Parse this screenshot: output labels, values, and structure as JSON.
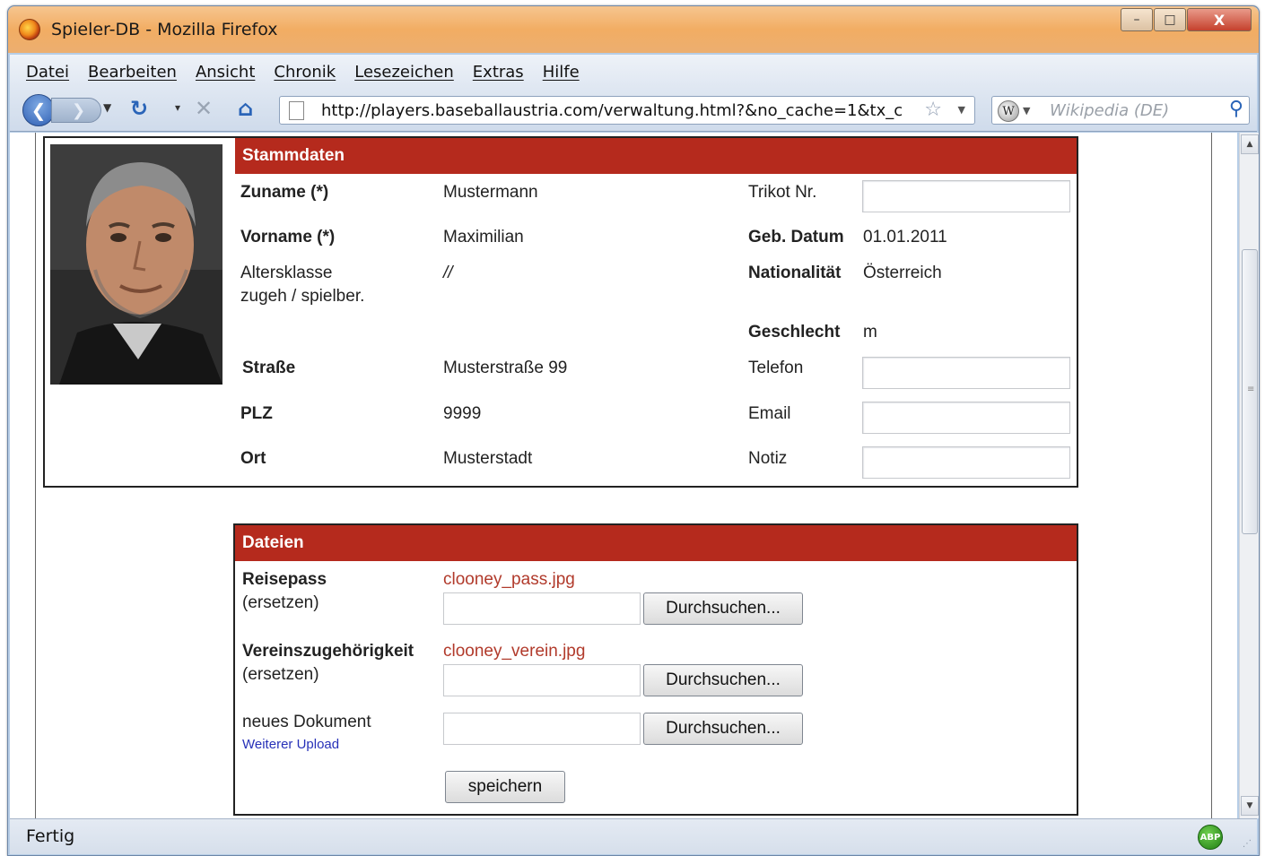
{
  "window": {
    "title": "Spieler-DB - Mozilla Firefox",
    "controls": {
      "minimize": "–",
      "maximize": "□",
      "close": "X"
    }
  },
  "menu": [
    "Datei",
    "Bearbeiten",
    "Ansicht",
    "Chronik",
    "Lesezeichen",
    "Extras",
    "Hilfe"
  ],
  "navigation": {
    "url": "http://players.baseballaustria.com/verwaltung.html?&no_cache=1&tx_c",
    "search_placeholder": "Wikipedia (DE)",
    "search_engine_icon": "W"
  },
  "status": {
    "text": "Fertig",
    "addon_badge": "ABP"
  },
  "stammdaten": {
    "heading": "Stammdaten",
    "zuname_label": "Zuname (*)",
    "zuname_value": "Mustermann",
    "vorname_label": "Vorname (*)",
    "vorname_value": "Maximilian",
    "altersklasse_label_1": "Altersklasse",
    "altersklasse_label_2": "zugeh / spielber.",
    "altersklasse_value": "//",
    "strasse_label": "Straße",
    "strasse_value": "Musterstraße 99",
    "plz_label": "PLZ",
    "plz_value": "9999",
    "ort_label": "Ort",
    "ort_value": "Musterstadt",
    "trikot_label": "Trikot Nr.",
    "trikot_value": "",
    "geburtsdatum_label": "Geb. Datum",
    "geburtsdatum_value": "01.01.2011",
    "nationalitaet_label": "Nationalität",
    "nationalitaet_value": "Österreich",
    "geschlecht_label": "Geschlecht",
    "geschlecht_value": "m",
    "telefon_label": "Telefon",
    "telefon_value": "",
    "email_label": "Email",
    "email_value": "",
    "notiz_label": "Notiz",
    "notiz_value": ""
  },
  "dateien": {
    "heading": "Dateien",
    "reisepass_label": "Reisepass",
    "reisepass_sub": "(ersetzen)",
    "reisepass_file": "clooney_pass.jpg",
    "verein_label": "Vereinszugehörigkeit",
    "verein_sub": "(ersetzen)",
    "verein_file": "clooney_verein.jpg",
    "neues_label": "neues Dokument",
    "weiterer_upload": "Weiterer Upload",
    "browse_label": "Durchsuchen...",
    "save_label": "speichern"
  },
  "colors": {
    "section_header": "#b52a1d",
    "file_link": "#b13a2b",
    "link": "#2731b8"
  }
}
